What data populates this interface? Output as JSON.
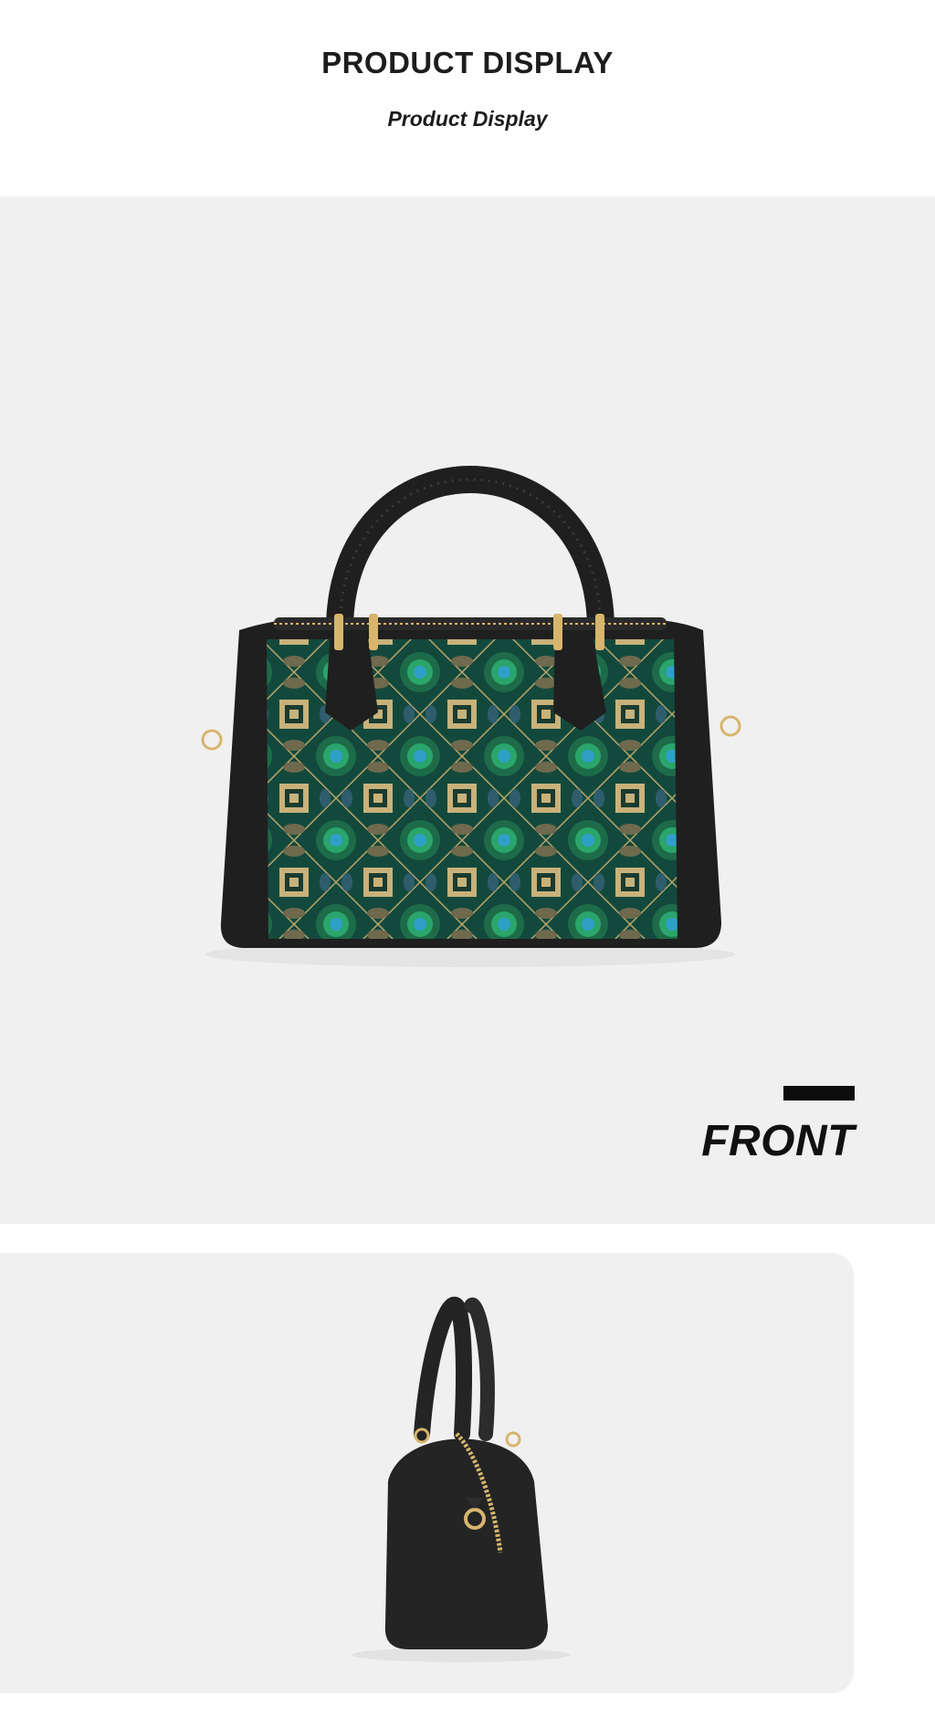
{
  "header": {
    "title": "PRODUCT DISPLAY",
    "subtitle": "Product Display"
  },
  "front_view": {
    "label": "FRONT",
    "bag": {
      "leather_color": "#1f1f20",
      "fabric_color": "#13493c",
      "accent_green": "#2aa56b",
      "accent_blue": "#2e9fc7",
      "accent_gold": "#c8b27a",
      "hardware_color": "#d7b56d"
    }
  },
  "side_view": {
    "bag": {
      "leather_color": "#242425",
      "hardware_color": "#d7b56d"
    }
  },
  "colors": {
    "panel_background": "#f0f0f0",
    "text": "#1d1d1d"
  }
}
